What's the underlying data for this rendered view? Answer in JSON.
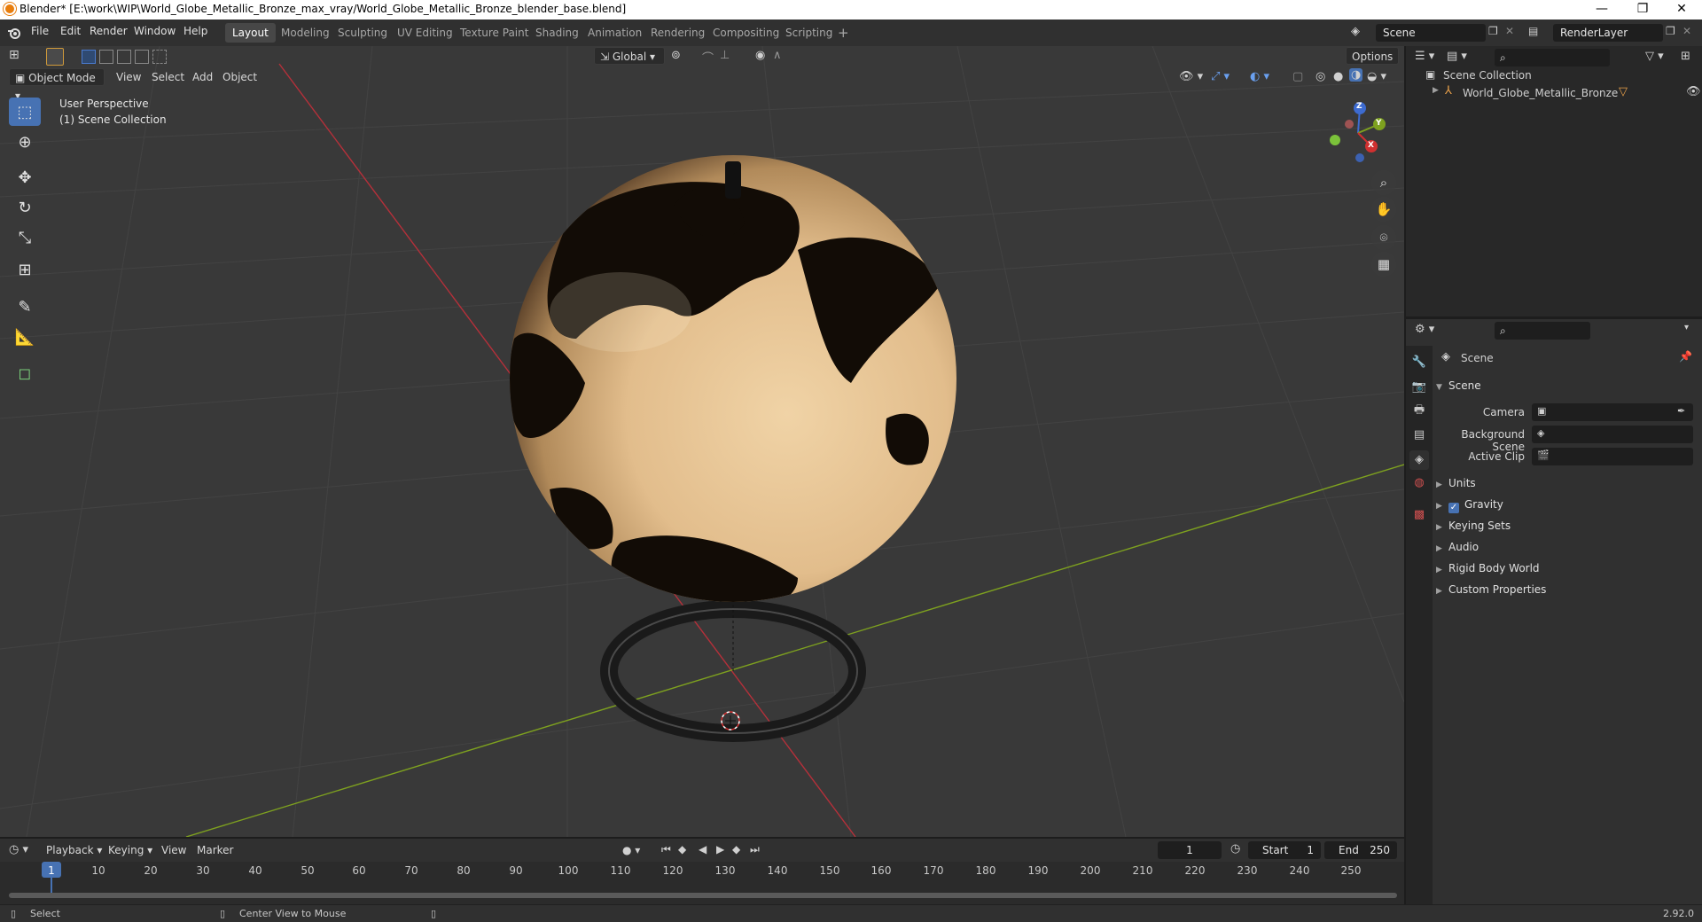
{
  "titlebar": {
    "title": "Blender* [E:\\work\\WIP\\World_Globe_Metallic_Bronze_max_vray/World_Globe_Metallic_Bronze_blender_base.blend]",
    "minimize": "—",
    "restore": "❐",
    "close": "✕"
  },
  "menu": {
    "items": [
      "File",
      "Edit",
      "Render",
      "Window",
      "Help"
    ],
    "workspaces": [
      "Layout",
      "Modeling",
      "Sculpting",
      "UV Editing",
      "Texture Paint",
      "Shading",
      "Animation",
      "Rendering",
      "Compositing",
      "Scripting"
    ],
    "active_workspace": "Layout",
    "add_workspace": "+",
    "scene_label": "Scene",
    "render_layer_label": "RenderLayer"
  },
  "viewport": {
    "mode": "Object Mode",
    "menus": [
      "View",
      "Select",
      "Add",
      "Object"
    ],
    "transform_orientation": "Global",
    "options_label": "Options",
    "perspective_text": "User Perspective",
    "collection_text": "(1) Scene Collection",
    "gizmo_axes": {
      "x": "X",
      "y": "Y",
      "z": "Z"
    }
  },
  "outliner": {
    "root": "Scene Collection",
    "items": [
      {
        "label": "World_Globe_Metallic_Bronze"
      }
    ]
  },
  "properties": {
    "context": "Scene",
    "panel_title": "Scene",
    "fields": [
      {
        "label": "Camera"
      },
      {
        "label": "Background Scene"
      },
      {
        "label": "Active Clip"
      }
    ],
    "subpanels": [
      "Units",
      "Gravity",
      "Keying Sets",
      "Audio",
      "Rigid Body World",
      "Custom Properties"
    ],
    "gravity_checked": true
  },
  "timeline": {
    "menus": [
      "Playback",
      "Keying",
      "View",
      "Marker"
    ],
    "current_frame": "1",
    "start_label": "Start",
    "start_value": "1",
    "end_label": "End",
    "end_value": "250",
    "ruler": [
      "1",
      "10",
      "20",
      "30",
      "40",
      "50",
      "60",
      "70",
      "80",
      "90",
      "100",
      "110",
      "120",
      "130",
      "140",
      "150",
      "160",
      "170",
      "180",
      "190",
      "200",
      "210",
      "220",
      "230",
      "240",
      "250"
    ]
  },
  "statusbar": {
    "select": "Select",
    "center_view": "Center View to Mouse",
    "version": "2.92.0"
  },
  "colors": {
    "accent": "#4772b3",
    "x_axis": "#b5303a",
    "y_axis": "#7ea11f",
    "bronze": "#e8c79a"
  }
}
